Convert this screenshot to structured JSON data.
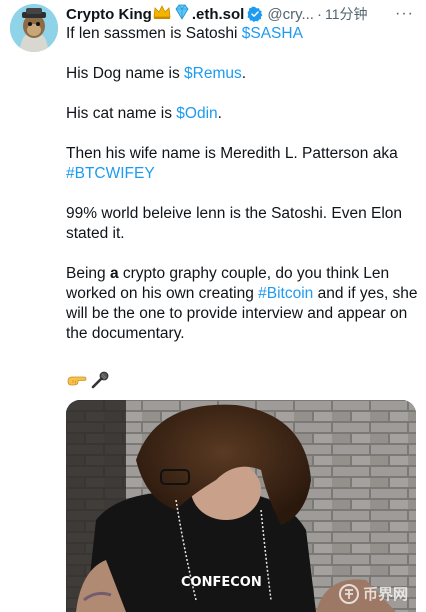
{
  "tweet": {
    "author_name": "Crypto King",
    "author_suffix": ".eth.sol",
    "handle": "@cry...",
    "separator": "·",
    "time": "11分钟",
    "more": "···",
    "lines": {
      "l1_text": "If len sassmen is Satoshi ",
      "l1_tag": "$SASHA",
      "l2_text": "His Dog name is ",
      "l2_tag": "$Remus",
      "l2_end": ".",
      "l3_text": "His cat name is ",
      "l3_tag": "$Odin",
      "l3_end": ".",
      "l4_text": "Then his wife name is Meredith L. Patterson aka",
      "l4_tag": "#BTCWIFEY",
      "l5_text": "99% world beleive lenn is the Satoshi. Even Elon stated it.",
      "l6_pre": "Being ",
      "l6_bold": "a",
      "l6_mid": " crypto graphy couple, do you think Len worked on his own creating ",
      "l6_tag": "#Bitcoin",
      "l6_end": " and if yes, she will be the one to provide interview and appear on the documentary."
    },
    "emojis": [
      "pointing-hand-icon",
      "microphone-icon"
    ],
    "media_shirt_text": "CONFECON",
    "watermark": "币界网"
  },
  "colors": {
    "link": "#1d9bf0",
    "text": "#0f1419",
    "muted": "#536471",
    "verified": "#1d9bf0"
  }
}
